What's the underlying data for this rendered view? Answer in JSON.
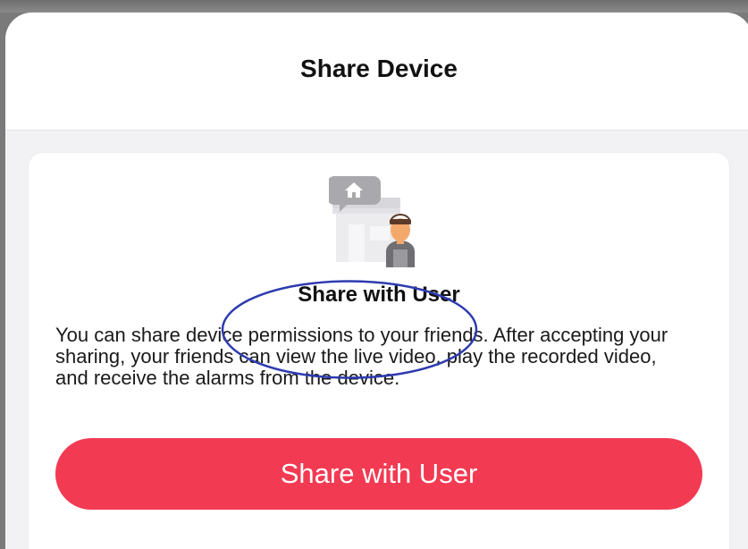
{
  "sheet": {
    "title": "Share Device"
  },
  "card": {
    "illustration_icon": "store-with-user-icon",
    "title": "Share with User",
    "description": "You can share device permissions to your friends. After accepting your sharing, your friends can view the live video, play the recorded video, and receive the alarms from the device.",
    "button_label": "Share with User"
  },
  "colors": {
    "accent": "#f23a52",
    "annotation": "#2e3bb0",
    "background": "#f2f2f4"
  }
}
